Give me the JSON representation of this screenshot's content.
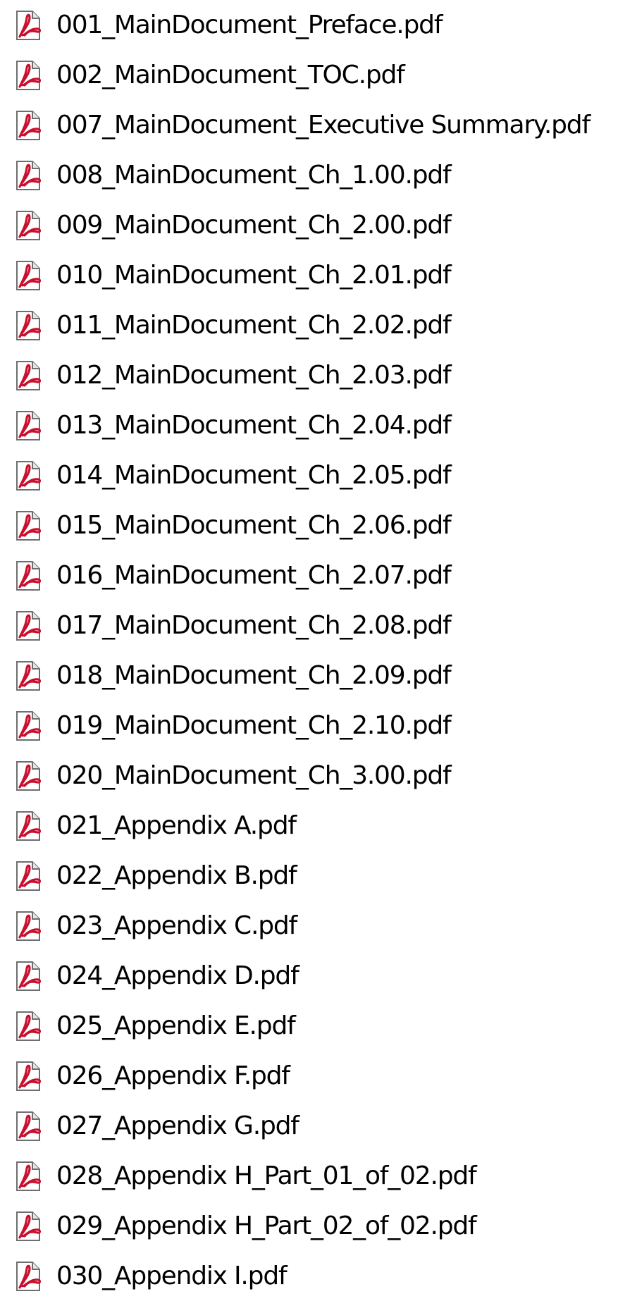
{
  "file_list": {
    "icon": "pdf-file-icon",
    "accent_color": "#c8102e",
    "items": [
      {
        "name": "001_MainDocument_Preface.pdf"
      },
      {
        "name": "002_MainDocument_TOC.pdf"
      },
      {
        "name": "007_MainDocument_Executive Summary.pdf"
      },
      {
        "name": "008_MainDocument_Ch_1.00.pdf"
      },
      {
        "name": "009_MainDocument_Ch_2.00.pdf"
      },
      {
        "name": "010_MainDocument_Ch_2.01.pdf"
      },
      {
        "name": "011_MainDocument_Ch_2.02.pdf"
      },
      {
        "name": "012_MainDocument_Ch_2.03.pdf"
      },
      {
        "name": "013_MainDocument_Ch_2.04.pdf"
      },
      {
        "name": "014_MainDocument_Ch_2.05.pdf"
      },
      {
        "name": "015_MainDocument_Ch_2.06.pdf"
      },
      {
        "name": "016_MainDocument_Ch_2.07.pdf"
      },
      {
        "name": "017_MainDocument_Ch_2.08.pdf"
      },
      {
        "name": "018_MainDocument_Ch_2.09.pdf"
      },
      {
        "name": "019_MainDocument_Ch_2.10.pdf"
      },
      {
        "name": "020_MainDocument_Ch_3.00.pdf"
      },
      {
        "name": "021_Appendix A.pdf"
      },
      {
        "name": "022_Appendix B.pdf"
      },
      {
        "name": "023_Appendix C.pdf"
      },
      {
        "name": "024_Appendix D.pdf"
      },
      {
        "name": "025_Appendix E.pdf"
      },
      {
        "name": "026_Appendix F.pdf"
      },
      {
        "name": "027_Appendix G.pdf"
      },
      {
        "name": "028_Appendix H_Part_01_of_02.pdf"
      },
      {
        "name": "029_Appendix H_Part_02_of_02.pdf"
      },
      {
        "name": "030_Appendix I.pdf"
      }
    ]
  }
}
